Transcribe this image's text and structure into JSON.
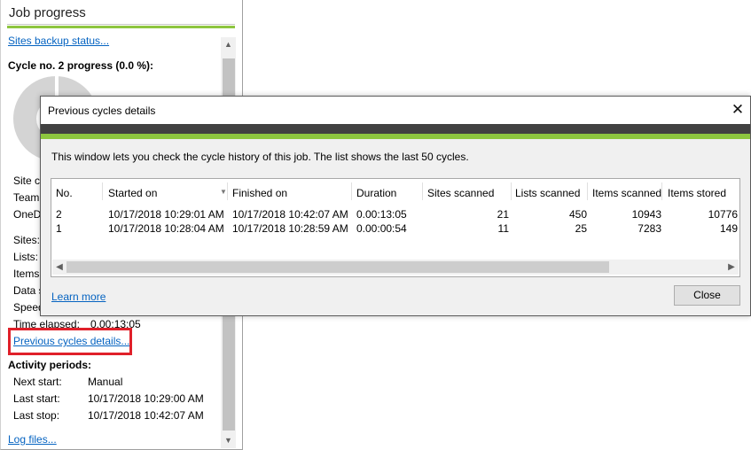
{
  "job_panel": {
    "title": "Job progress",
    "sites_backup_link": "Sites backup status...",
    "cycle_progress": "Cycle no. 2 progress (0.0 %):",
    "partial_labels": [
      "Site c",
      "Team",
      "OneD"
    ],
    "stat_labels": [
      "Sites:",
      "Lists:",
      "Items:",
      "Data s",
      "Speed"
    ],
    "time_elapsed_label": "Time elapsed:",
    "time_elapsed_value": "0.00:13:05",
    "previous_cycles_link": "Previous cycles details...",
    "activity_periods_heading": "Activity periods:",
    "next_start_label": "Next start:",
    "next_start_value": "Manual",
    "last_start_label": "Last start:",
    "last_start_value": "10/17/2018 10:29:00 AM",
    "last_stop_label": "Last stop:",
    "last_stop_value": "10/17/2018 10:42:07 AM",
    "log_files_link": "Log files..."
  },
  "dialog": {
    "title": "Previous cycles details",
    "close_glyph": "✕",
    "description": "This window lets you check the cycle history of this job. The list shows the last 50 cycles.",
    "columns": [
      "No.",
      "Started on",
      "Finished on",
      "Duration",
      "Sites scanned",
      "Lists scanned",
      "Items scanned",
      "Items stored"
    ],
    "rows": [
      [
        "2",
        "10/17/2018 10:29:01 AM",
        "10/17/2018 10:42:07 AM",
        "0.00:13:05",
        "21",
        "450",
        "10943",
        "10776"
      ],
      [
        "1",
        "10/17/2018 10:28:04 AM",
        "10/17/2018 10:28:59 AM",
        "0.00:00:54",
        "11",
        "25",
        "7283",
        "149"
      ]
    ],
    "learn_more_link": "Learn more",
    "close_button": "Close"
  },
  "colors": {
    "accent_green": "#8dc63f",
    "dark_band": "#414141",
    "link_blue": "#0563c1",
    "highlight_red": "#e0202a"
  }
}
